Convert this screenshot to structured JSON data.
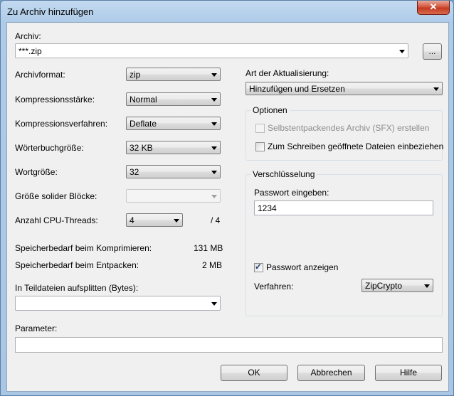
{
  "window": {
    "title": "Zu Archiv hinzufügen",
    "close_label": "✕"
  },
  "archive": {
    "label": "Archiv:",
    "value": "***.zip",
    "browse_label": "..."
  },
  "left": {
    "format_label": "Archivformat:",
    "format_value": "zip",
    "level_label": "Kompressionsstärke:",
    "level_value": "Normal",
    "method_label": "Kompressionsverfahren:",
    "method_value": "Deflate",
    "dict_label": "Wörterbuchgröße:",
    "dict_value": "32 KB",
    "word_label": "Wortgröße:",
    "word_value": "32",
    "solid_label": "Größe solider Blöcke:",
    "solid_value": "",
    "threads_label": "Anzahl CPU-Threads:",
    "threads_value": "4",
    "threads_max": "/ 4",
    "mem_compress_label": "Speicherbedarf beim Komprimieren:",
    "mem_compress_value": "131 MB",
    "mem_extract_label": "Speicherbedarf beim Entpacken:",
    "mem_extract_value": "2 MB",
    "split_label": "In Teildateien aufsplitten (Bytes):",
    "split_value": ""
  },
  "right": {
    "update_label": "Art der Aktualisierung:",
    "update_value": "Hinzufügen und Ersetzen",
    "options_title": "Optionen",
    "sfx_label": "Selbstentpackendes Archiv (SFX) erstellen",
    "sfx_checked": false,
    "shared_label": "Zum Schreiben geöffnete Dateien einbeziehen",
    "shared_checked": false,
    "encryption_title": "Verschlüsselung",
    "password_label": "Passwort eingeben:",
    "password_value": "1234",
    "show_password_label": "Passwort anzeigen",
    "show_password_checked": true,
    "method_label": "Verfahren:",
    "method_value": "ZipCrypto"
  },
  "params": {
    "label": "Parameter:",
    "value": ""
  },
  "buttons": {
    "ok": "OK",
    "cancel": "Abbrechen",
    "help": "Hilfe"
  }
}
